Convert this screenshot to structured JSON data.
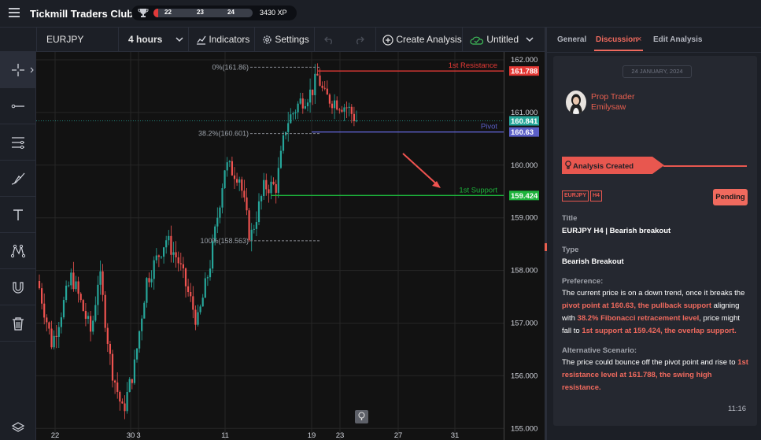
{
  "app": {
    "title": "Tickmill Traders Club",
    "xp": {
      "level_current": "22",
      "level_mid": "23",
      "level_next": "24",
      "points": "3430 XP",
      "progress": 0.05
    }
  },
  "toolbar": {
    "symbol": "EURJPY",
    "interval": "4 hours",
    "indicators_label": "Indicators",
    "settings_label": "Settings",
    "create_label": "Create Analysis",
    "layout_name": "Untitled"
  },
  "left_tools": [
    "crosshair-icon",
    "line-icon",
    "lines-menu-icon",
    "brush-icon",
    "text-icon",
    "pattern-icon",
    "magnet-icon",
    "trash-icon",
    "layers-icon"
  ],
  "chart": {
    "price_labels": [
      "162.000",
      "161.000",
      "160.000",
      "159.000",
      "158.000",
      "157.000",
      "156.000",
      "155.000"
    ],
    "date_labels": [
      "22",
      "30",
      "3",
      "11",
      "19",
      "23",
      "27",
      "31"
    ],
    "level_lines": {
      "resistance": {
        "label": "1st Resistance",
        "price": "161.788",
        "color": "#e53935"
      },
      "pivot": {
        "label": "Pivot",
        "price": "160.63",
        "color": "#5b5fc7"
      },
      "support": {
        "label": "1st Support",
        "price": "159.424",
        "color": "#1db33b"
      }
    },
    "fib": {
      "top": "0%(161.86)",
      "mid": "38.2%(160.601)",
      "bottom": "100%(158.563)"
    },
    "last_price": "160.841",
    "last_price_color": "#26a69a"
  },
  "panel": {
    "tabs": [
      "General",
      "Discussion",
      "Edit Analysis"
    ],
    "active_tab": "Discussion",
    "accent": "#f06a5e",
    "date": "24 JANUARY, 2024",
    "author_role": "Prop Trader",
    "author_name": "Emilysaw",
    "status_banner": "Analysis Created",
    "tags": [
      "EURJPY",
      "H4"
    ],
    "status": "Pending",
    "title_label": "Title",
    "title_value": "EURJPY H4 | Bearish breakout",
    "type_label": "Type",
    "type_value": "Bearish Breakout",
    "preference_label": "Preference:",
    "preference_1": "The current price is on a down trend, once it breaks the ",
    "preference_2": "pivot point at 160.63, the pullback support",
    "preference_3": " aligning with ",
    "preference_4": "38.2% Fibonacci retracement level",
    "preference_5": ", price might fall to ",
    "preference_6": "1st support at 159.424, the overlap support.",
    "alt_label": "Alternative Scenario:",
    "alt_1": "The price could bounce off the pivot point and rise to ",
    "alt_2": "1st resistance level at 161.788, the swing high resistance.",
    "time": "11:16"
  }
}
